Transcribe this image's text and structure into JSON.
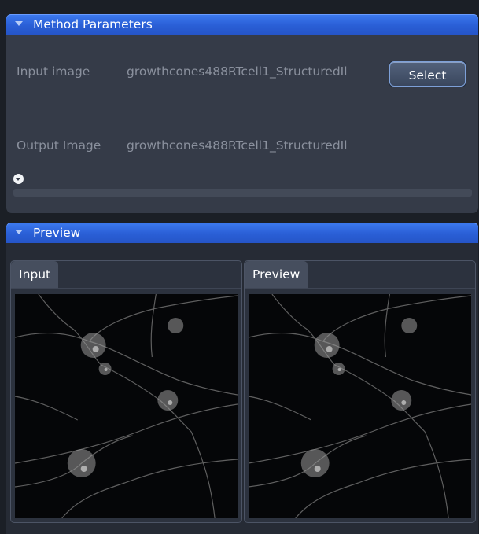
{
  "method_panel": {
    "title": "Method Parameters",
    "input_label": "Input image",
    "input_value": "growthcones488RTcell1_StructuredIl",
    "select_label": "Select",
    "output_label": "Output Image",
    "output_value": "growthcones488RTcell1_StructuredIl"
  },
  "preview_panel": {
    "title": "Preview",
    "input_tab": "Input",
    "preview_tab": "Preview"
  },
  "colors": {
    "header_blue": "#2a5fd6",
    "panel_bg": "#353b48",
    "button_border": "#7da0d8"
  }
}
